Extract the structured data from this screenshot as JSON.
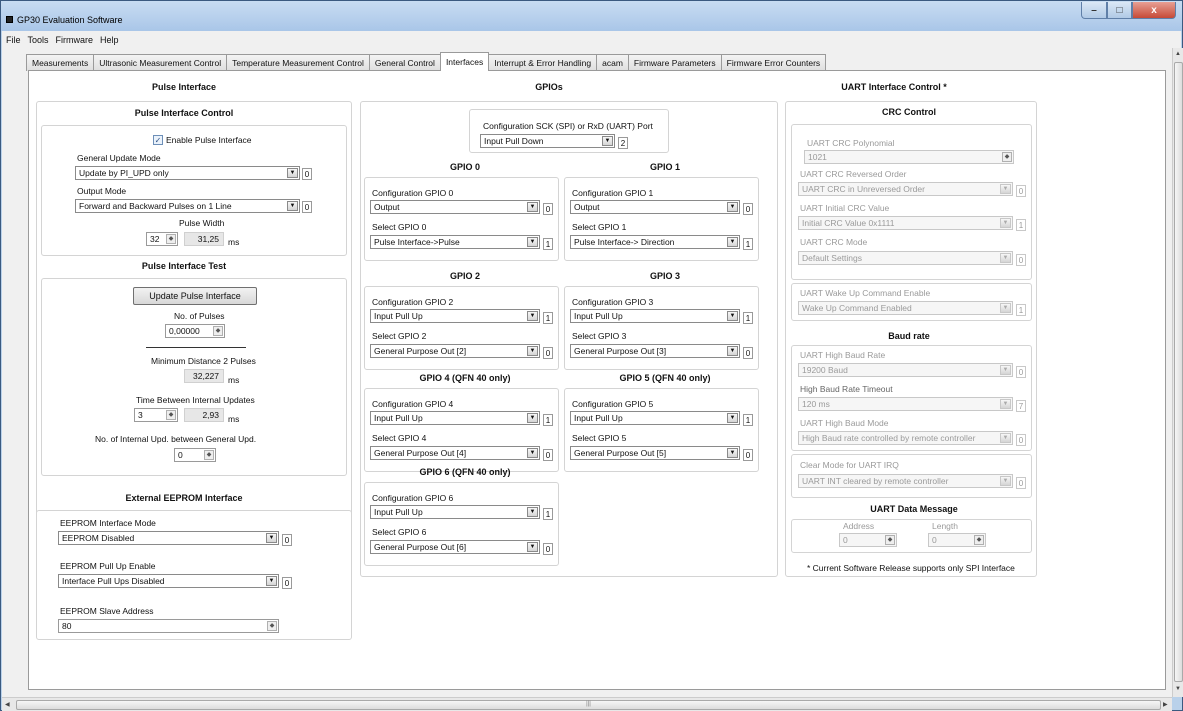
{
  "window": {
    "title": "GP30 Evaluation Software",
    "min": "–",
    "max": "□",
    "close": "x"
  },
  "menu": [
    "File",
    "Tools",
    "Firmware",
    "Help"
  ],
  "tabs": [
    "Measurements",
    "Ultrasonic Measurement Control",
    "Temperature Measurement Control",
    "General Control",
    "Interfaces",
    "Interrupt & Error Handling",
    "acam",
    "Firmware Parameters",
    "Firmware Error Counters"
  ],
  "pulse": {
    "title": "Pulse Interface",
    "control_title": "Pulse Interface Control",
    "enable_label": "Enable Pulse Interface",
    "update_mode_label": "General Update Mode",
    "update_mode_value": "Update by PI_UPD only",
    "update_mode_num": "0",
    "output_mode_label": "Output Mode",
    "output_mode_value": "Forward and Backward Pulses on 1 Line",
    "output_mode_num": "0",
    "width_label": "Pulse Width",
    "width_value": "32",
    "width_ms": "31,25",
    "unit": "ms",
    "test_title": "Pulse Interface Test",
    "update_button": "Update Pulse Interface",
    "npulses_label": "No. of Pulses",
    "npulses_value": "0,00000",
    "mindist_label": "Minimum Distance 2 Pulses",
    "mindist_value": "32,227",
    "tbi_label": "Time Between Internal Updates",
    "tbi_value": "3",
    "tbi_ms": "2,93",
    "ninternal_label": "No. of Internal Upd. between General Upd.",
    "ninternal_value": "0"
  },
  "eeprom": {
    "title": "External EEPROM Interface",
    "mode_label": "EEPROM Interface Mode",
    "mode_value": "EEPROM Disabled",
    "mode_num": "0",
    "pullup_label": "EEPROM Pull Up Enable",
    "pullup_value": "Interface Pull Ups Disabled",
    "pullup_num": "0",
    "slave_label": "EEPROM Slave Address",
    "slave_value": "80"
  },
  "gpio": {
    "title": "GPIOs",
    "sck_label": "Configuration SCK (SPI) or RxD (UART) Port",
    "sck_value": "Input Pull Down",
    "sck_num": "2",
    "items": [
      {
        "title": "GPIO 0",
        "conf_label": "Configuration GPIO 0",
        "conf_value": "Output",
        "conf_num": "0",
        "sel_label": "Select GPIO 0",
        "sel_value": "Pulse Interface->Pulse",
        "sel_num": "1"
      },
      {
        "title": "GPIO 1",
        "conf_label": "Configuration GPIO 1",
        "conf_value": "Output",
        "conf_num": "0",
        "sel_label": "Select GPIO 1",
        "sel_value": "Pulse Interface-> Direction",
        "sel_num": "1"
      },
      {
        "title": "GPIO 2",
        "conf_label": "Configuration GPIO 2",
        "conf_value": "Input Pull Up",
        "conf_num": "1",
        "sel_label": "Select GPIO 2",
        "sel_value": "General Purpose Out [2]",
        "sel_num": "0"
      },
      {
        "title": "GPIO 3",
        "conf_label": "Configuration GPIO 3",
        "conf_value": "Input Pull Up",
        "conf_num": "1",
        "sel_label": "Select GPIO 3",
        "sel_value": "General Purpose Out [3]",
        "sel_num": "0"
      },
      {
        "title": "GPIO 4 (QFN 40 only)",
        "conf_label": "Configuration GPIO 4",
        "conf_value": "Input Pull Up",
        "conf_num": "1",
        "sel_label": "Select GPIO 4",
        "sel_value": "General Purpose Out [4]",
        "sel_num": "0"
      },
      {
        "title": "GPIO 5 (QFN 40 only)",
        "conf_label": "Configuration GPIO 5",
        "conf_value": "Input Pull Up",
        "conf_num": "1",
        "sel_label": "Select GPIO 5",
        "sel_value": "General Purpose Out [5]",
        "sel_num": "0"
      },
      {
        "title": "GPIO 6 (QFN 40 only)",
        "conf_label": "Configuration GPIO 6",
        "conf_value": "Input Pull Up",
        "conf_num": "1",
        "sel_label": "Select GPIO 6",
        "sel_value": "General Purpose Out [6]",
        "sel_num": "0"
      }
    ]
  },
  "uart": {
    "title": "UART Interface Control *",
    "crc_title": "CRC Control",
    "poly_label": "UART CRC Polynomial",
    "poly_value": "1021",
    "rev_label": "UART CRC Reversed Order",
    "rev_value": "UART CRC in Unreversed Order",
    "rev_num": "0",
    "init_label": "UART Initial CRC Value",
    "init_value": "Initial CRC Value 0x1111",
    "init_num": "1",
    "mode_label": "UART CRC Mode",
    "mode_value": "Default Settings",
    "mode_num": "0",
    "wake_label": "UART Wake Up Command Enable",
    "wake_value": "Wake Up Command Enabled",
    "wake_num": "1",
    "baud_title": "Baud rate",
    "hb_label": "UART High Baud Rate",
    "hb_value": "19200 Baud",
    "hb_num": "0",
    "hbt_label": "High Baud Rate Timeout",
    "hbt_value": "120 ms",
    "hbt_num": "7",
    "hbm_label": "UART High Baud Mode",
    "hbm_value": "High Baud rate controlled by remote controller",
    "hbm_num": "0",
    "clr_label": "Clear Mode for UART IRQ",
    "clr_value": "UART INT cleared by remote controller",
    "clr_num": "0",
    "msg_title": "UART Data Message",
    "addr_label": "Address",
    "addr_value": "0",
    "len_label": "Length",
    "len_value": "0",
    "note": "* Current Software Release supports only SPI Interface"
  }
}
